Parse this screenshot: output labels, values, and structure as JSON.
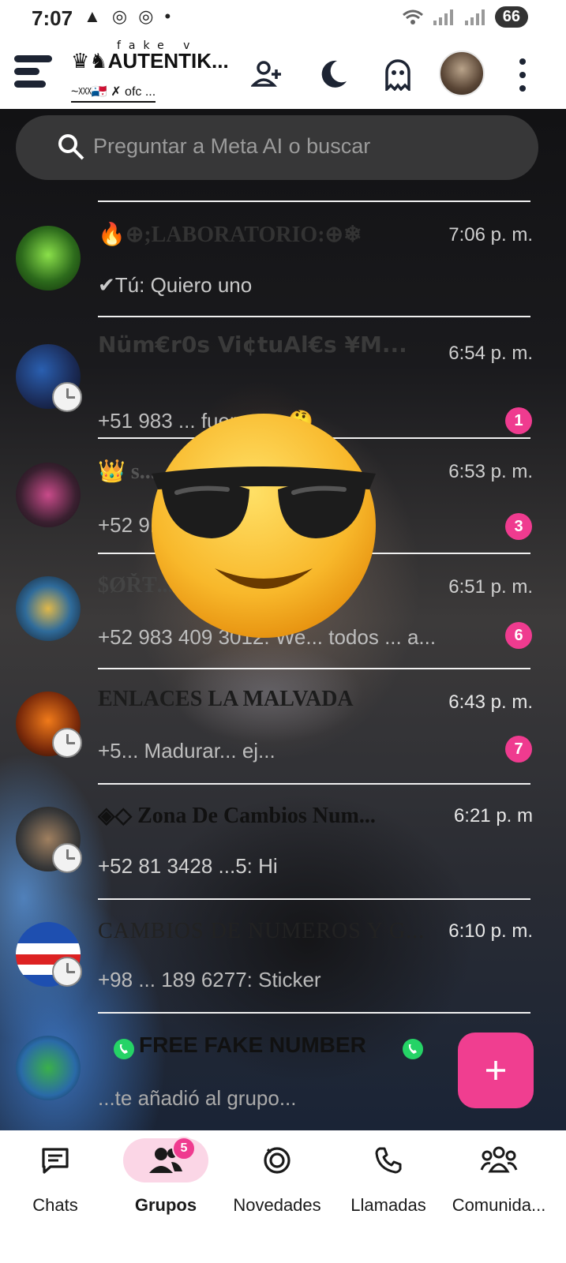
{
  "status_bar": {
    "time": "7:07",
    "left_icons": "▲ ◎ ◎ •",
    "battery": "66"
  },
  "app_bar": {
    "brand_small": "fake  v",
    "brand_main": "♛♞AUTENTIK...",
    "brand_sub": "~ᵡᵡᵡ🇵🇦 ✗ ofc ...",
    "icons": [
      "menu-icon",
      "add-person-icon",
      "moon-icon",
      "ghost-icon",
      "profile-avatar",
      "more-vert-icon"
    ]
  },
  "search": {
    "placeholder": "Preguntar a Meta AI o buscar"
  },
  "chats": [
    {
      "title": "🔥⊕;LABORATORIO:⊕❄",
      "time": "7:06 p. m.",
      "subtitle": "✔Tú: Quiero uno",
      "badge": ""
    },
    {
      "title": "Nüm€r0s Vi¢tuAl€s ¥M...",
      "time": "6:54 p. m.",
      "subtitle": "+51 983 ... fueron ... 🤔",
      "badge": "1"
    },
    {
      "title": "👑 s...",
      "time": "6:53 p. m.",
      "subtitle": "+52 9...",
      "badge": "3"
    },
    {
      "title": "$ØŘŦ... ¥",
      "time": "6:51 p. m.",
      "subtitle": "+52 983 409 3012: We... todos ... a...",
      "badge": "6"
    },
    {
      "title": "ENLACES LA MALVADA",
      "time": "6:43 p. m.",
      "subtitle": "+5... Madurar... ej...",
      "badge": "7"
    },
    {
      "title": "◈◇ Zona De Cambios Num...",
      "time": "6:21 p. m",
      "subtitle": "+52 81 3428 ...5: Hi",
      "badge": ""
    },
    {
      "title": "CAMBIOS DE NUMEROS Y G...",
      "time": "6:10 p. m.",
      "subtitle": "+98 ... 189 6277: Sticker",
      "badge": ""
    },
    {
      "title": "FREE FAKE NUMBER",
      "time": "",
      "subtitle": "...te añadió al grupo...",
      "badge": ""
    }
  ],
  "fab": {
    "label": "+"
  },
  "bottom_nav": [
    {
      "label": "Chats",
      "badge": ""
    },
    {
      "label": "Grupos",
      "badge": "5"
    },
    {
      "label": "Novedades",
      "badge": ""
    },
    {
      "label": "Llamadas",
      "badge": ""
    },
    {
      "label": "Comunida...",
      "badge": ""
    }
  ],
  "colors": {
    "accent": "#ef3b8f",
    "nav_active_bg": "#fbd6e6",
    "icon_dark": "#1d2433"
  }
}
